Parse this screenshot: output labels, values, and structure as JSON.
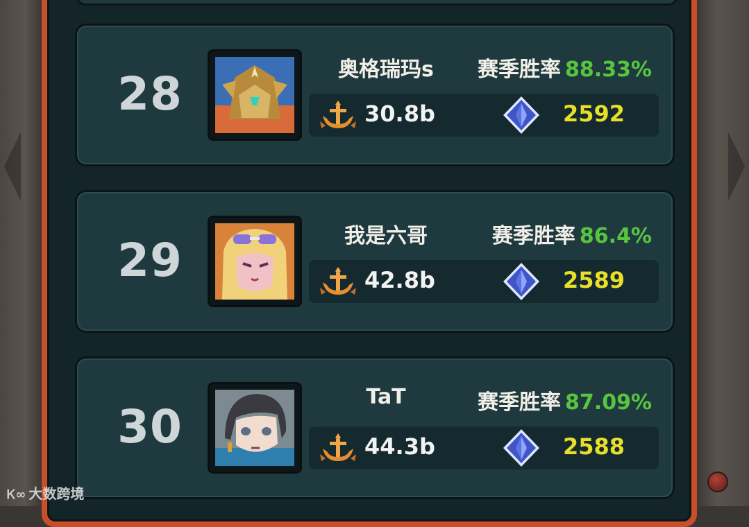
{
  "watermark": {
    "logo": "Ꮶ∞",
    "text": "大数跨境"
  },
  "leaderboard": {
    "win_rate_label": "赛季胜率",
    "entries": [
      {
        "rank": "28",
        "name": "奥格瑞玛s",
        "win_rate": "88.33%",
        "power": "30.8b",
        "score": "2592",
        "avatar_icon": "golden-armored-knight-avatar"
      },
      {
        "rank": "29",
        "name": "我是六哥",
        "win_rate": "86.4%",
        "power": "42.8b",
        "score": "2589",
        "avatar_icon": "blonde-girl-sunglasses-avatar"
      },
      {
        "rank": "30",
        "name": "TaT",
        "win_rate": "87.09%",
        "power": "44.3b",
        "score": "2588",
        "avatar_icon": "dark-haired-boy-avatar"
      }
    ]
  },
  "colors": {
    "frame_accent": "#c94e2a",
    "win_rate_green": "#58c53f",
    "score_yellow": "#e9df2a",
    "card_bg": "#1f3a3f"
  }
}
